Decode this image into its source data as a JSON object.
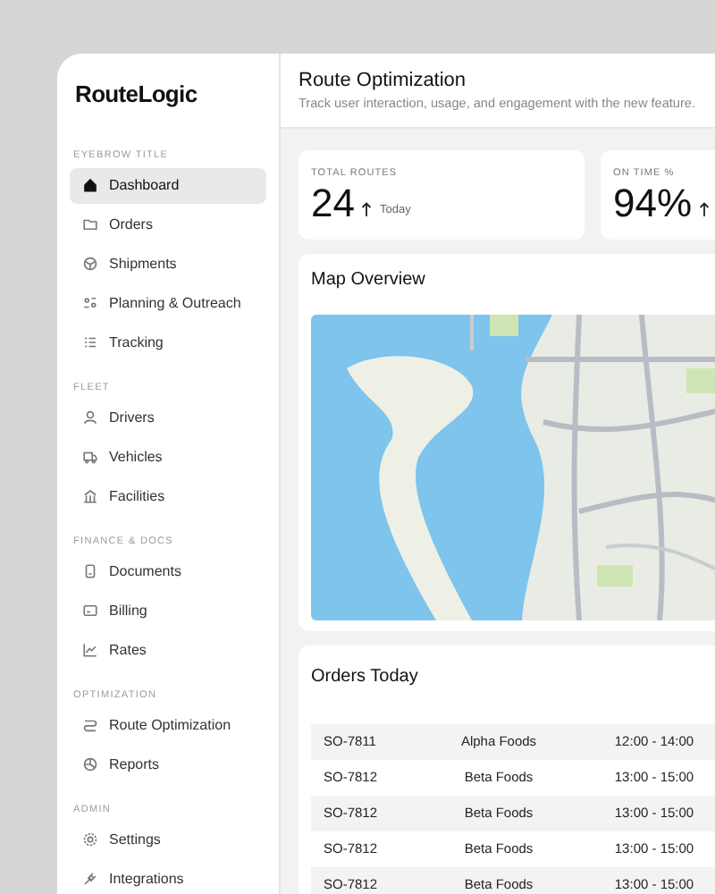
{
  "app": {
    "name": "RouteLogic"
  },
  "sidebar": {
    "sections": [
      {
        "title": "EYEBROW TITLE",
        "items": [
          {
            "label": "Dashboard",
            "selected": true
          },
          {
            "label": "Orders",
            "selected": false
          },
          {
            "label": "Shipments",
            "selected": false
          },
          {
            "label": "Planning & Outreach",
            "selected": false
          },
          {
            "label": "Tracking",
            "selected": false
          }
        ]
      },
      {
        "title": "FLEET",
        "items": [
          {
            "label": "Drivers",
            "selected": false
          },
          {
            "label": "Vehicles",
            "selected": false
          },
          {
            "label": "Facilities",
            "selected": false
          }
        ]
      },
      {
        "title": "FINANCE & DOCS",
        "items": [
          {
            "label": "Documents",
            "selected": false
          },
          {
            "label": "Billing",
            "selected": false
          },
          {
            "label": "Rates",
            "selected": false
          }
        ]
      },
      {
        "title": "OPTIMIZATION",
        "items": [
          {
            "label": "Route Optimization",
            "selected": false
          },
          {
            "label": "Reports",
            "selected": false
          }
        ]
      },
      {
        "title": "ADMIN",
        "items": [
          {
            "label": "Settings",
            "selected": false
          },
          {
            "label": "Integrations",
            "selected": false
          }
        ]
      }
    ]
  },
  "header": {
    "title": "Route Optimization",
    "subtitle": "Track user interaction, usage, and engagement with the new feature."
  },
  "stats": [
    {
      "label": "TOTAL ROUTES",
      "value": "24",
      "note": "Today"
    },
    {
      "label": "ON TIME %",
      "value": "94%"
    }
  ],
  "map": {
    "title": "Map Overview"
  },
  "orders": {
    "title": "Orders Today",
    "rows": [
      [
        "SO-7811",
        "Alpha Foods",
        "12:00 - 14:00"
      ],
      [
        "SO-7812",
        "Beta Foods",
        "13:00 - 15:00"
      ],
      [
        "SO-7812",
        "Beta Foods",
        "13:00 - 15:00"
      ],
      [
        "SO-7812",
        "Beta Foods",
        "13:00 - 15:00"
      ],
      [
        "SO-7812",
        "Beta Foods",
        "13:00 - 15:00"
      ]
    ]
  }
}
